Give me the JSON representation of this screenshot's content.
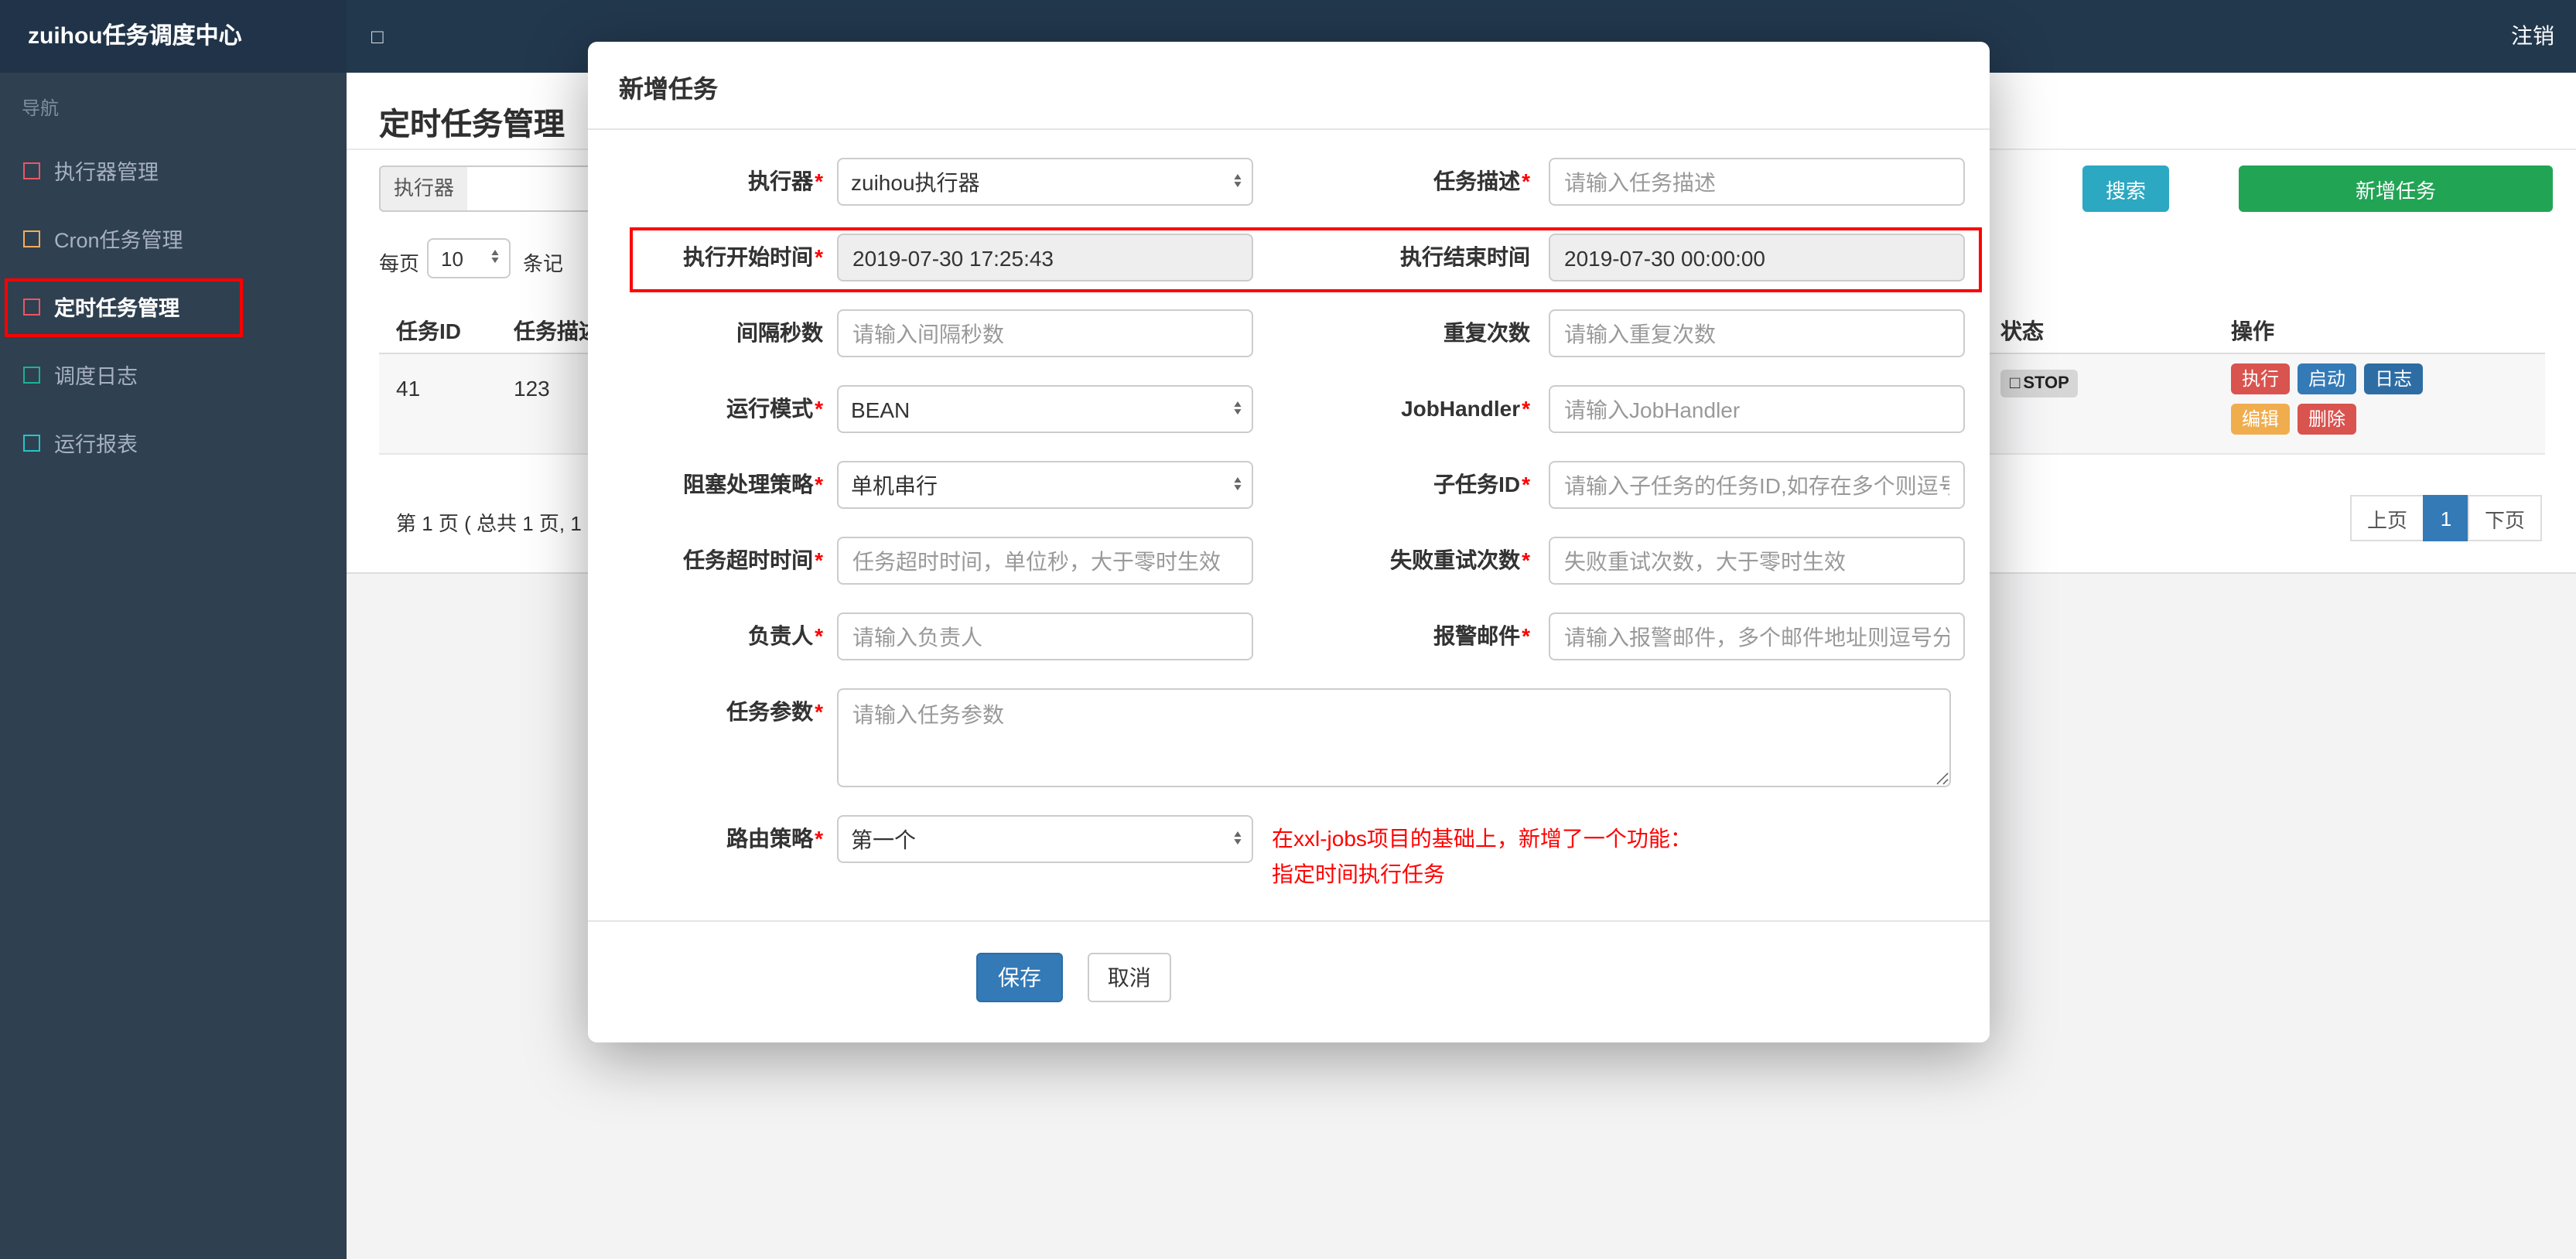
{
  "colors": {
    "navbar_bg": "#22384d",
    "sidebar_bg": "#2f4050",
    "accent_blue": "#337ab7",
    "search_teal": "#2ca8c2",
    "add_green": "#22a455",
    "danger_red": "#d9534f",
    "warning_orange": "#f0ad4e",
    "log_blue": "#2e6da4",
    "annotation_red": "#ff0000"
  },
  "icons": {
    "caret_up": "▲",
    "caret_down": "▼",
    "square": "□",
    "stop_square": "□"
  },
  "navbar": {
    "brand": "zuihou任务调度中心",
    "logout": "注销"
  },
  "sidebar": {
    "nav_label": "导航",
    "items": [
      {
        "label": "执行器管理"
      },
      {
        "label": "Cron任务管理"
      },
      {
        "label": "定时任务管理"
      },
      {
        "label": "调度日志"
      },
      {
        "label": "运行报表"
      }
    ]
  },
  "page": {
    "title": "定时任务管理",
    "filter": {
      "executor_addon": "执行器",
      "search_button": "搜索",
      "add_button": "新增任务"
    },
    "per_page": {
      "prefix": "每页",
      "value": "10",
      "suffix": "条记"
    },
    "table": {
      "headers": {
        "id": "任务ID",
        "desc": "任务描述",
        "status": "状态",
        "ops": "操作"
      },
      "row": {
        "id": "41",
        "desc": "123",
        "status": "STOP",
        "actions": {
          "run": "执行",
          "start": "启动",
          "log": "日志",
          "edit": "编辑",
          "del": "删除"
        }
      }
    },
    "pagination": {
      "info": "第 1 页 ( 总共 1 页, 1",
      "prev": "上页",
      "current": "1",
      "next": "下页"
    }
  },
  "modal": {
    "title": "新增任务",
    "required_mark": "*",
    "fields": {
      "executor": {
        "label": "执行器",
        "value": "zuihou执行器"
      },
      "job_desc": {
        "label": "任务描述",
        "placeholder": "请输入任务描述"
      },
      "start_time": {
        "label": "执行开始时间",
        "value": "2019-07-30 17:25:43"
      },
      "end_time": {
        "label": "执行结束时间",
        "value": "2019-07-30 00:00:00"
      },
      "interval": {
        "label": "间隔秒数",
        "placeholder": "请输入间隔秒数"
      },
      "repeat_count": {
        "label": "重复次数",
        "placeholder": "请输入重复次数"
      },
      "run_mode": {
        "label": "运行模式",
        "value": "BEAN"
      },
      "job_handler": {
        "label": "JobHandler",
        "placeholder": "请输入JobHandler"
      },
      "block_strategy": {
        "label": "阻塞处理策略",
        "value": "单机串行"
      },
      "child_job_id": {
        "label": "子任务ID",
        "placeholder": "请输入子任务的任务ID,如存在多个则逗号分隔"
      },
      "timeout": {
        "label": "任务超时时间",
        "placeholder": "任务超时时间，单位秒，大于零时生效"
      },
      "fail_retry": {
        "label": "失败重试次数",
        "placeholder": "失败重试次数，大于零时生效"
      },
      "author": {
        "label": "负责人",
        "placeholder": "请输入负责人"
      },
      "alarm_email": {
        "label": "报警邮件",
        "placeholder": "请输入报警邮件，多个邮件地址则逗号分隔"
      },
      "job_param": {
        "label": "任务参数",
        "placeholder": "请输入任务参数"
      },
      "route_strategy": {
        "label": "路由策略",
        "value": "第一个"
      }
    },
    "note_line1": "在xxl-jobs项目的基础上，新增了一个功能：",
    "note_line2": "指定时间执行任务",
    "save_button": "保存",
    "cancel_button": "取消"
  }
}
